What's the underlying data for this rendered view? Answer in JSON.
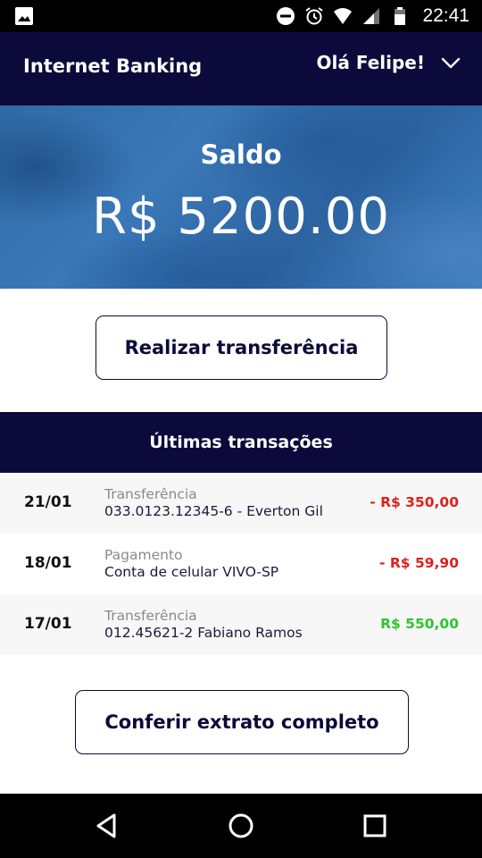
{
  "status_bar": {
    "time": "22:41",
    "left_icon": "image-icon",
    "right_icons": [
      "do-not-disturb-icon",
      "alarm-icon",
      "wifi-icon",
      "signal-icon",
      "battery-icon"
    ]
  },
  "app_bar": {
    "title": "Internet Banking",
    "greeting": "Olá Felipe!",
    "menu_icon": "chevron-down-icon"
  },
  "balance": {
    "label": "Saldo",
    "value": "R$ 5200.00"
  },
  "actions": {
    "transfer_label": "Realizar transferência",
    "statement_label": "Conferir extrato completo"
  },
  "transactions": {
    "title": "Últimas transações",
    "items": [
      {
        "date": "21/01",
        "type": "Transferência",
        "description": "033.0123.12345-6 - Everton Gil",
        "amount": "- R$ 350,00",
        "direction": "debit"
      },
      {
        "date": "18/01",
        "type": "Pagamento",
        "description": "Conta de celular VIVO-SP",
        "amount": "- R$ 59,90",
        "direction": "debit"
      },
      {
        "date": "17/01",
        "type": "Transferência",
        "description": "012.45621-2 Fabiano Ramos",
        "amount": "R$ 550,00",
        "direction": "credit"
      }
    ]
  },
  "colors": {
    "primary": "#0b0a3a",
    "debit": "#e0201c",
    "credit": "#2ec42e",
    "banner": "#3472b0"
  },
  "nav_bar": {
    "icons": [
      "back-icon",
      "home-icon",
      "recents-icon"
    ]
  }
}
